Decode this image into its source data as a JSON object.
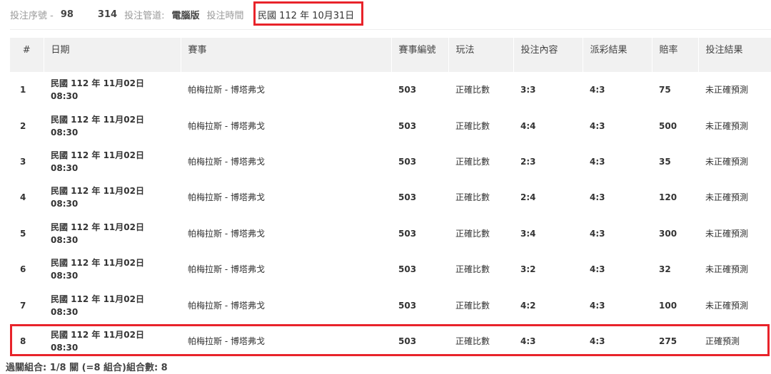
{
  "topbar": {
    "serial_label": "投注序號 -",
    "serial_value_a": "98",
    "serial_value_b": "314",
    "channel_label": "投注管道:",
    "channel_value": "電腦版",
    "time_label": "投注時間",
    "time_value": "民國 112 年 10月31日"
  },
  "columns": [
    "#",
    "日期",
    "賽事",
    "賽事編號",
    "玩法",
    "投注內容",
    "派彩結果",
    "賠率",
    "投注結果"
  ],
  "rows": [
    {
      "n": "1",
      "date1": "民國 112 年 11月02日",
      "date2": "08:30",
      "match": "帕梅拉斯 - 博塔弗戈",
      "code": "503",
      "play": "正確比數",
      "bet": "3:3",
      "result": "4:3",
      "odds": "75",
      "outcome": "未正確預測"
    },
    {
      "n": "2",
      "date1": "民國 112 年 11月02日",
      "date2": "08:30",
      "match": "帕梅拉斯 - 博塔弗戈",
      "code": "503",
      "play": "正確比數",
      "bet": "4:4",
      "result": "4:3",
      "odds": "500",
      "outcome": "未正確預測"
    },
    {
      "n": "3",
      "date1": "民國 112 年 11月02日",
      "date2": "08:30",
      "match": "帕梅拉斯 - 博塔弗戈",
      "code": "503",
      "play": "正確比數",
      "bet": "2:3",
      "result": "4:3",
      "odds": "35",
      "outcome": "未正確預測"
    },
    {
      "n": "4",
      "date1": "民國 112 年 11月02日",
      "date2": "08:30",
      "match": "帕梅拉斯 - 博塔弗戈",
      "code": "503",
      "play": "正確比數",
      "bet": "2:4",
      "result": "4:3",
      "odds": "120",
      "outcome": "未正確預測"
    },
    {
      "n": "5",
      "date1": "民國 112 年 11月02日",
      "date2": "08:30",
      "match": "帕梅拉斯 - 博塔弗戈",
      "code": "503",
      "play": "正確比數",
      "bet": "3:4",
      "result": "4:3",
      "odds": "300",
      "outcome": "未正確預測"
    },
    {
      "n": "6",
      "date1": "民國 112 年 11月02日",
      "date2": "08:30",
      "match": "帕梅拉斯 - 博塔弗戈",
      "code": "503",
      "play": "正確比數",
      "bet": "3:2",
      "result": "4:3",
      "odds": "32",
      "outcome": "未正確預測"
    },
    {
      "n": "7",
      "date1": "民國 112 年 11月02日",
      "date2": "08:30",
      "match": "帕梅拉斯 - 博塔弗戈",
      "code": "503",
      "play": "正確比數",
      "bet": "4:2",
      "result": "4:3",
      "odds": "100",
      "outcome": "未正確預測"
    },
    {
      "n": "8",
      "date1": "民國 112 年 11月02日",
      "date2": "08:30",
      "match": "帕梅拉斯 - 博塔弗戈",
      "code": "503",
      "play": "正確比數",
      "bet": "4:3",
      "result": "4:3",
      "odds": "275",
      "outcome": "正確預測"
    }
  ],
  "footer": "過關組合: 1/8 關 (=8 組合)組合數: 8",
  "colors": {
    "highlight": "#e8232a",
    "header_bg": "#f1f1f1"
  }
}
